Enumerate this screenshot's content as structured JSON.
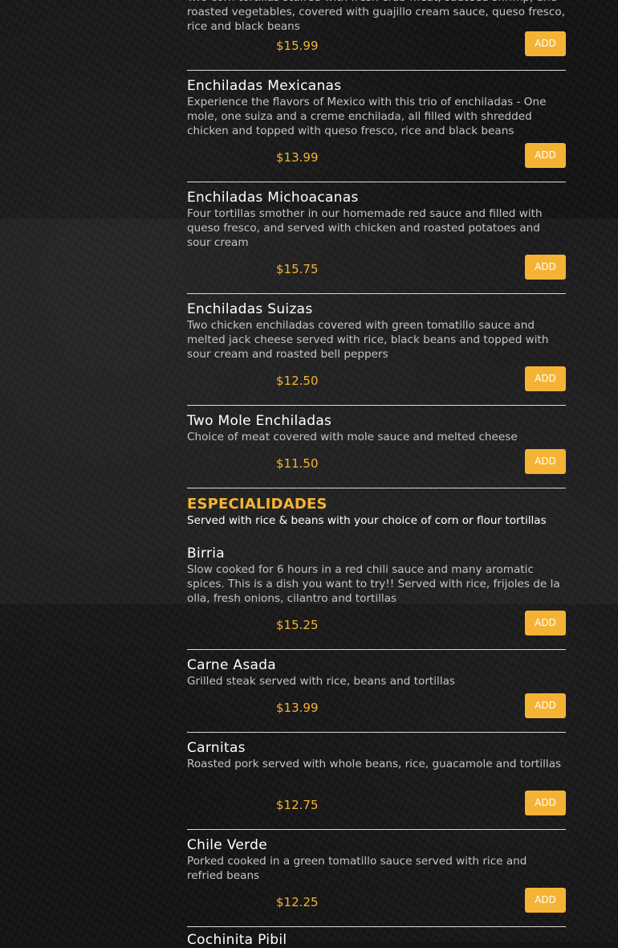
{
  "accent_color": "#f5b335",
  "top_item": {
    "desc_tail": "Two corn tortillas stuffed with fresh crab meat, sauteed shrimp, and roasted vegetables, covered with guajillo cream sauce, queso fresco, rice and black beans",
    "price": "$15.99",
    "add_label": "ADD"
  },
  "enchiladas": [
    {
      "name": "Enchiladas Mexicanas",
      "desc": "Experience the flavors of Mexico with this trio of enchiladas - One mole, one suiza and a creme enchilada, all filled with shredded chicken and topped with queso fresco, rice and black beans",
      "price": "$13.99",
      "add_label": "ADD"
    },
    {
      "name": "Enchiladas Michoacanas",
      "desc": "Four tortillas smother in our homemade red sauce and filled with queso fresco, and served with chicken and roasted potatoes and sour cream",
      "price": "$15.75",
      "add_label": "ADD"
    },
    {
      "name": "Enchiladas Suizas",
      "desc": "Two chicken enchiladas covered with green tomatillo sauce and melted jack cheese served with rice, black beans and topped with sour cream and roasted bell peppers",
      "price": "$12.50",
      "add_label": "ADD"
    },
    {
      "name": "Two Mole Enchiladas",
      "desc": "Choice of meat covered with mole sauce and melted cheese",
      "price": "$11.50",
      "add_label": "ADD"
    }
  ],
  "especialidades": {
    "title": "ESPECIALIDADES",
    "subtitle": "Served with rice & beans with your choice of corn or flour tortillas",
    "items": [
      {
        "name": "Birria",
        "desc": "Slow cooked for 6 hours in a red chili sauce and many aromatic spices. This is a dish you want to try!! Served with rice, frijoles de la olla, fresh onions, cilantro and tortillas",
        "price": "$15.25",
        "add_label": "ADD"
      },
      {
        "name": "Carne Asada",
        "desc": "Grilled steak served with rice, beans and tortillas",
        "price": "$13.99",
        "add_label": "ADD"
      },
      {
        "name": "Carnitas",
        "desc": "Roasted pork served with whole beans, rice, guacamole and tortillas",
        "price": "$12.75",
        "add_label": "ADD"
      },
      {
        "name": "Chile Verde",
        "desc": "Porked cooked in a green tomatillo sauce served with rice and refried beans",
        "price": "$12.25",
        "add_label": "ADD"
      },
      {
        "name": "Cochinita Pibil"
      }
    ]
  }
}
